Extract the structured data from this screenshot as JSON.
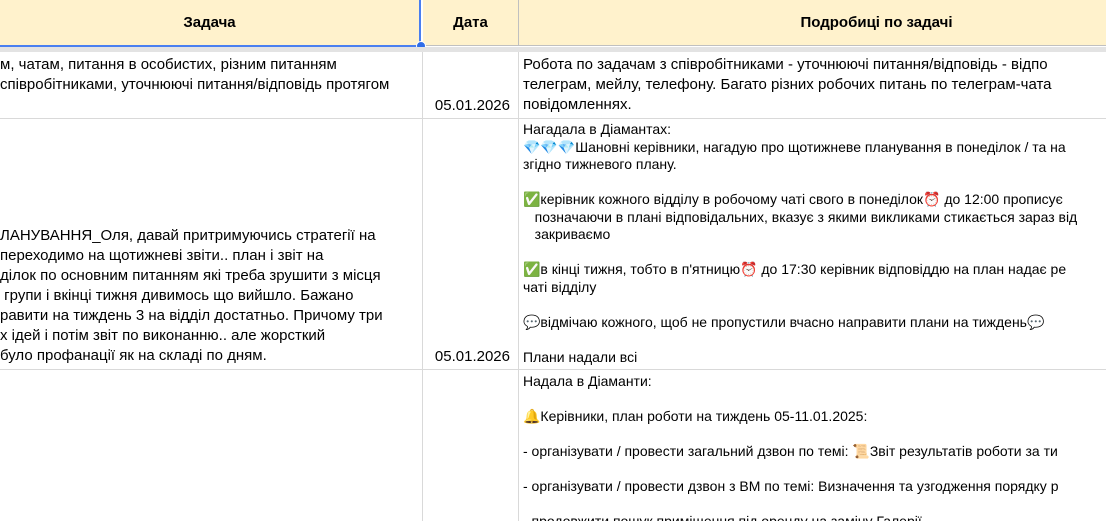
{
  "columns": {
    "task": "Задача",
    "date": "Дата",
    "details": "Подробиці по задачі"
  },
  "rows": [
    {
      "task": "м, чатам, питання в особистих, різним питанням\nспівробітниками, уточнюючі питання/відповідь протягом",
      "date": "05.01.2026",
      "details": "Робота по задачам з співробітниками - уточнюючі питання/відповідь - відпо\nтелеграм, мейлу, телефону. Багато різних робочих питань по телеграм-чата\nповідомленнях."
    },
    {
      "task": "ЛАНУВАННЯ_Оля, давай притримуючись стратегії на\nпереходимо на щотижневі звіти.. план і звіт на\nділок по основним питанням які треба зрушити з місця\n групи і вкінці тижня дивимось що вийшло. Бажано\nравити на тиждень 3 на відділ достатньо. Причому три\nх ідей і потім звіт по виконанню.. але жорсткий\nбуло профанації як на складі по дням.",
      "date": "05.01.2026",
      "details": "Нагадала в Діамантах:\n💎💎💎Шановні керівники, нагадую про щотижневе планування в понеділок / та на\nзгідно тижневого плану.\n\n✅керівник кожного відділу в робочому чаті свого в понеділок⏰ до 12:00 прописує\n   позначаючи в плані відповідальних, вказує з якими викликами стикається зараз від\n   закриваємо\n\n✅в кінці тижня, тобто в п'ятницю⏰ до 17:30 керівник відповіддю на план надає ре\nчаті відділу\n\n💬відмічаю кожного, щоб не пропустили вчасно направити плани на тиждень💬\n\nПлани надали всі"
    },
    {
      "task": "",
      "date": "",
      "details": "Надала в Діаманти:\n\n🔔Керівники, план роботи на тиждень 05-11.01.2025:\n\n- організувати / провести загальний дзвон по темі: 📜Звіт результатів роботи за ти\n\n- організувати / провести дзвон з ВМ по темі: Визначення та узгодження порядку р\n\n- продовжити пошук приміщення під оренду на заміну Галерії"
    }
  ]
}
